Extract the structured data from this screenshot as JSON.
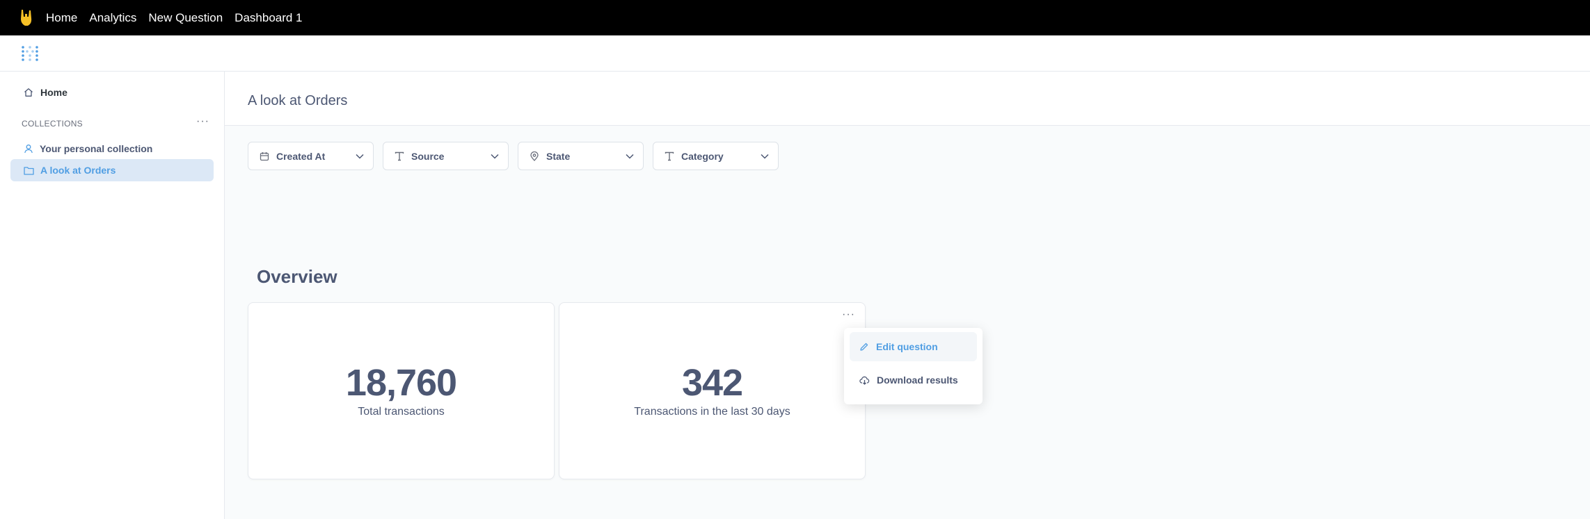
{
  "topnav": {
    "links": [
      "Home",
      "Analytics",
      "New Question",
      "Dashboard 1"
    ]
  },
  "sidebar": {
    "home_label": "Home",
    "collections_label": "COLLECTIONS",
    "more_label": "···",
    "items": [
      {
        "label": "Your personal collection",
        "icon": "person-icon"
      },
      {
        "label": "A look at Orders",
        "icon": "folder-icon",
        "active": true
      }
    ]
  },
  "page": {
    "title": "A look at Orders"
  },
  "filters": [
    {
      "label": "Created At",
      "icon": "calendar-icon"
    },
    {
      "label": "Source",
      "icon": "text-icon"
    },
    {
      "label": "State",
      "icon": "location-icon"
    },
    {
      "label": "Category",
      "icon": "text-icon"
    }
  ],
  "section": {
    "heading": "Overview"
  },
  "cards": [
    {
      "value": "18,760",
      "caption": "Total transactions"
    },
    {
      "value": "342",
      "caption": "Transactions in the last 30 days",
      "more_label": "···"
    }
  ],
  "menu": {
    "items": [
      {
        "label": "Edit question",
        "icon": "pencil-icon"
      },
      {
        "label": "Download results",
        "icon": "cloud-download-icon"
      }
    ]
  },
  "colors": {
    "brand": "#509ee3",
    "text": "#4c5773",
    "topbar": "#000000",
    "active_bg": "#dce8f6"
  }
}
